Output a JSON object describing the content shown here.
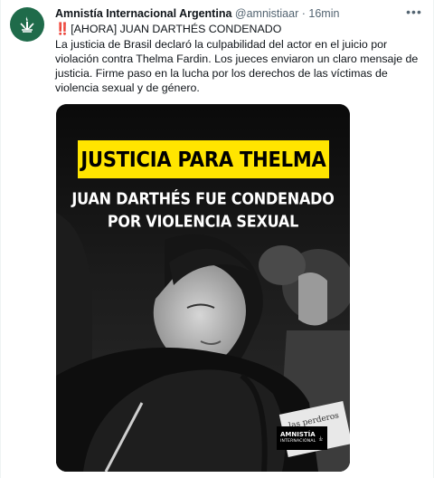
{
  "tweet": {
    "author_name": "Amnistía Internacional Argentina",
    "handle": "@amnistiaar",
    "separator": "·",
    "time": "16min",
    "more_icon": "more-dots-icon",
    "headline_emoji": "‼️",
    "headline": "[AHORA] JUAN DARTHÉS CONDENADO",
    "body": "La justicia de Brasil declaró la culpabilidad del actor en el juicio por violación contra Thelma Fardin. Los jueces enviaron un claro mensaje de justicia. Firme paso en la lucha por los derechos de las víctimas de violencia sexual y de género.",
    "avatar_icon": "amnesty-candle-icon"
  },
  "media": {
    "banner": "JUSTICIA PARA THELMA",
    "subtitle_line1": "JUAN DARTHÉS FUE CONDENADO",
    "subtitle_line2": "POR VIOLENCIA SEXUAL",
    "sign_text": "las perderos",
    "logo_line1": "AMNISTÍA",
    "logo_line2": "INTERNACIONAL",
    "banner_color": "#ffe500"
  }
}
